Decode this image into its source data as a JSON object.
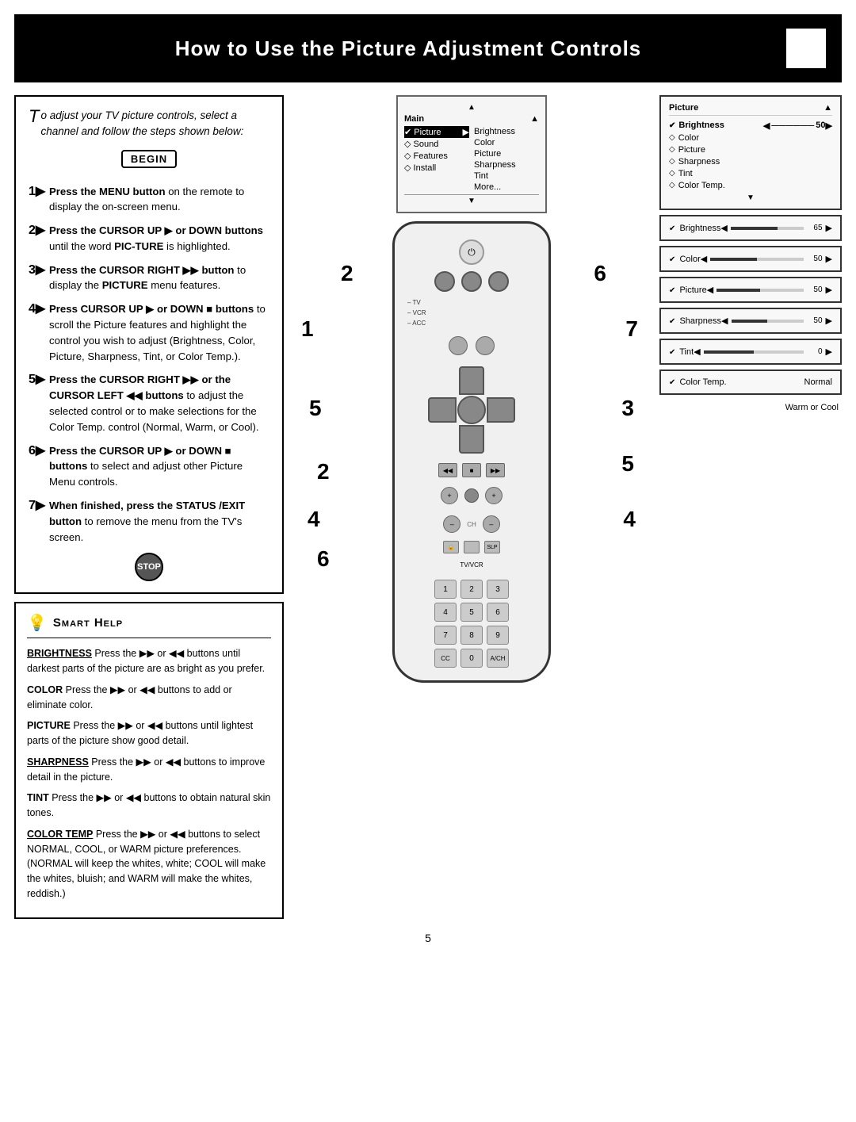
{
  "header": {
    "title": "How to Use the Picture Adjustment Controls"
  },
  "intro": {
    "drop_cap": "T",
    "text": "o adjust your TV picture controls, select a channel and follow the steps shown below:"
  },
  "begin_label": "BEGIN",
  "stop_label": "STOP",
  "steps": [
    {
      "num": "1",
      "text": "Press the MENU button on the remote to display the on-screen menu."
    },
    {
      "num": "2",
      "text": "Press the CURSOR UP ▶ or DOWN buttons until the word PICTURE is highlighted."
    },
    {
      "num": "3",
      "text": "Press the CURSOR RIGHT ▶▶ button to display the PICTURE menu features."
    },
    {
      "num": "4",
      "text": "Press CURSOR UP ▶ or DOWN ■ buttons to scroll the Picture features and highlight the control you wish to adjust (Brightness, Color, Picture, Sharpness, Tint, or Color Temp.)."
    },
    {
      "num": "5",
      "text": "Press the CURSOR RIGHT ▶▶ or the CURSOR LEFT ◀◀ buttons to adjust the selected control or to make selections for the Color Temp. control (Normal, Warm, or Cool)."
    },
    {
      "num": "6",
      "text": "Press the CURSOR UP ▶ or DOWN ■ buttons to select and adjust other Picture Menu controls."
    },
    {
      "num": "7",
      "text": "When finished, press the STATUS /EXIT button to remove the menu from the TV's screen."
    }
  ],
  "smart_help": {
    "title": "Smart Help",
    "items": [
      {
        "term": "BRIGHTNESS",
        "desc": "Press the ▶▶ or ◀◀ buttons until darkest parts of the picture are as bright as you prefer."
      },
      {
        "term": "COLOR",
        "desc": "Press the ▶▶ or ◀◀ buttons to add or eliminate color."
      },
      {
        "term": "PICTURE",
        "desc": "Press the ▶▶ or ◀◀ buttons until lightest parts of the picture show good detail."
      },
      {
        "term": "SHARPNESS",
        "desc": "Press the ▶▶ or ◀◀ buttons to improve detail in the picture."
      },
      {
        "term": "TINT",
        "desc": "Press the ▶▶ or ◀◀ buttons to obtain natural skin tones."
      },
      {
        "term": "COLOR TEMP",
        "desc": "Press the ▶▶ or ◀◀ buttons to select NORMAL, COOL, or WARM picture preferences. (NORMAL will keep the whites, white; COOL will make the whites, bluish; and WARM will make the whites, reddish.)"
      }
    ]
  },
  "menu_preview": {
    "title": "Main",
    "arrow_up": "▲",
    "arrow_down": "▼",
    "rows": [
      {
        "left": "✔ Picture",
        "right": "▶",
        "sub": "Brightness",
        "highlighted": false
      },
      {
        "left": "◇ Sound",
        "right": "",
        "sub": "Color",
        "highlighted": false
      },
      {
        "left": "◇ Features",
        "right": "",
        "sub": "Picture",
        "highlighted": false
      },
      {
        "left": "◇ Install",
        "right": "",
        "sub": "Sharpness",
        "highlighted": false
      },
      {
        "left": "",
        "right": "",
        "sub": "Tint",
        "highlighted": false
      },
      {
        "left": "",
        "right": "",
        "sub": "More...",
        "highlighted": false
      }
    ]
  },
  "tv_screens": [
    {
      "type": "menu",
      "title": "Picture",
      "title_arrow": "▲",
      "items": [
        {
          "check": "✔",
          "name": "Brightness",
          "has_slider": true,
          "value": 50,
          "percent": 50
        },
        {
          "check": "◇",
          "name": "Color",
          "has_slider": false
        },
        {
          "check": "◇",
          "name": "Picture",
          "has_slider": false
        },
        {
          "check": "◇",
          "name": "Sharpness",
          "has_slider": false
        },
        {
          "check": "◇",
          "name": "Tint",
          "has_slider": false
        },
        {
          "check": "◇",
          "name": "Color Temp.",
          "has_slider": false
        }
      ],
      "arrow_down": "▼"
    },
    {
      "type": "single",
      "name": "Brightness",
      "check": "✔",
      "value": 65,
      "percent": 65
    },
    {
      "type": "single",
      "name": "Color",
      "check": "✔",
      "value": 50,
      "percent": 50
    },
    {
      "type": "single",
      "name": "Picture",
      "check": "✔",
      "value": 50,
      "percent": 50
    },
    {
      "type": "single",
      "name": "Sharpness",
      "check": "✔",
      "value": 50,
      "percent": 50
    },
    {
      "type": "single",
      "name": "Tint",
      "check": "✔",
      "value": 0,
      "percent": 50
    },
    {
      "type": "single-text",
      "name": "Color Temp.",
      "check": "✔",
      "text_value": "Normal"
    }
  ],
  "warm_cool_note": "Warm\nor\nCool",
  "page_number": "5",
  "remote": {
    "labels": [
      "– TV",
      "– VCR",
      "– ACC"
    ],
    "step_numbers": [
      "1",
      "2",
      "3",
      "4",
      "5",
      "6",
      "7"
    ],
    "numpad": [
      "1",
      "2",
      "3",
      "4",
      "5",
      "6",
      "7",
      "8",
      "9",
      "CC",
      "0",
      "A/CH"
    ]
  }
}
